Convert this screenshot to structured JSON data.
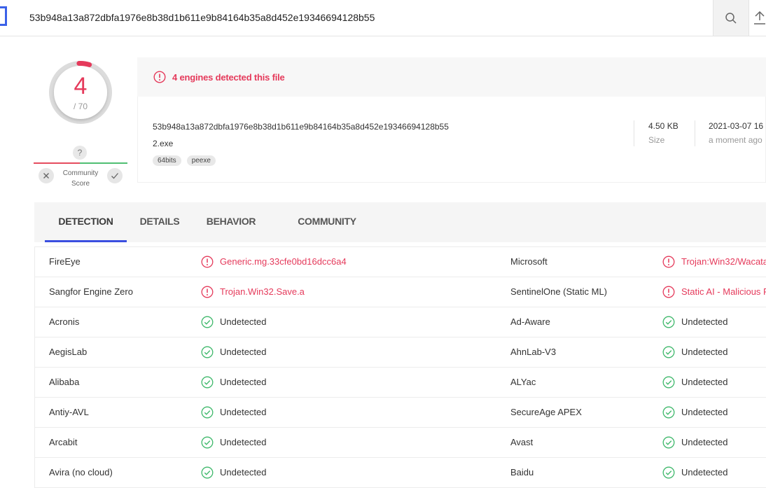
{
  "search": {
    "value": "53b948a13a872dbfa1976e8b38d1b611e9b84164b35a8d452e19346694128b55"
  },
  "score": {
    "detected": "4",
    "total": "/ 70"
  },
  "community": {
    "question": "?",
    "label_line1": "Community",
    "label_line2": "Score"
  },
  "banner": {
    "text": "4 engines detected this file"
  },
  "file": {
    "hash": "53b948a13a872dbfa1976e8b38d1b611e9b84164b35a8d452e19346694128b55",
    "name": "2.exe",
    "tags": [
      "64bits",
      "peexe"
    ],
    "size_value": "4.50 KB",
    "size_label": "Size",
    "date_value": "2021-03-07 16",
    "date_label": "a moment ago"
  },
  "tabs": [
    {
      "label": "DETECTION",
      "active": true
    },
    {
      "label": "DETAILS",
      "active": false
    },
    {
      "label": "BEHAVIOR",
      "active": false
    },
    {
      "label": "COMMUNITY",
      "active": false
    }
  ],
  "detections": [
    {
      "engine1": "FireEye",
      "result1": "Generic.mg.33cfe0bd16dcc6a4",
      "status1": "malicious",
      "engine2": "Microsoft",
      "result2": "Trojan:Win32/Wacata",
      "status2": "malicious"
    },
    {
      "engine1": "Sangfor Engine Zero",
      "result1": "Trojan.Win32.Save.a",
      "status1": "malicious",
      "engine2": "SentinelOne (Static ML)",
      "result2": "Static AI - Malicious P",
      "status2": "malicious"
    },
    {
      "engine1": "Acronis",
      "result1": "Undetected",
      "status1": "clean",
      "engine2": "Ad-Aware",
      "result2": "Undetected",
      "status2": "clean"
    },
    {
      "engine1": "AegisLab",
      "result1": "Undetected",
      "status1": "clean",
      "engine2": "AhnLab-V3",
      "result2": "Undetected",
      "status2": "clean"
    },
    {
      "engine1": "Alibaba",
      "result1": "Undetected",
      "status1": "clean",
      "engine2": "ALYac",
      "result2": "Undetected",
      "status2": "clean"
    },
    {
      "engine1": "Antiy-AVL",
      "result1": "Undetected",
      "status1": "clean",
      "engine2": "SecureAge APEX",
      "result2": "Undetected",
      "status2": "clean"
    },
    {
      "engine1": "Arcabit",
      "result1": "Undetected",
      "status1": "clean",
      "engine2": "Avast",
      "result2": "Undetected",
      "status2": "clean"
    },
    {
      "engine1": "Avira (no cloud)",
      "result1": "Undetected",
      "status1": "clean",
      "engine2": "Baidu",
      "result2": "Undetected",
      "status2": "clean"
    }
  ],
  "colors": {
    "malicious": "#e53a5b",
    "clean": "#3fb86b",
    "accent": "#3b4fe0"
  },
  "icons": {
    "search": "magnifier-icon",
    "upload": "upload-icon",
    "malicious": "alert-circle-icon",
    "clean": "check-circle-icon"
  }
}
